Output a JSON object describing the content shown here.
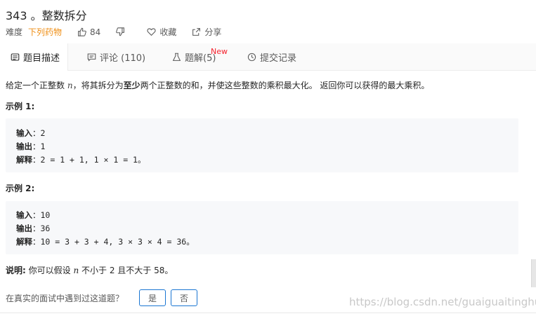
{
  "problem": {
    "title": "343 。整数拆分",
    "difficulty_label": "难度",
    "difficulty_value": "下列药物",
    "likes": "84",
    "favorite_label": "收藏",
    "share_label": "分享"
  },
  "tabs": [
    {
      "label": "题目描述"
    },
    {
      "label": "评论 (110)"
    },
    {
      "label": "题解(5)",
      "badge": "New"
    },
    {
      "label": "提交记录"
    }
  ],
  "description": {
    "part1": "给定一个正整数 ",
    "var": "n",
    "part2": "，将其拆分为",
    "bold": "至少",
    "part3": "两个正整数的和，并使这些整数的乘积最大化。 返回你可以获得的最大乘积。"
  },
  "examples": [
    {
      "title": "示例 1:",
      "input_label": "输入",
      "input": "：2",
      "output_label": "输出",
      "output": "：1",
      "explain_label": "解释",
      "explain": "：2 = 1 + 1, 1 × 1 = 1。"
    },
    {
      "title": "示例 2:",
      "input_label": "输入",
      "input": "：10",
      "output_label": "输出",
      "output": "：36",
      "explain_label": "解释",
      "explain": "：10 = 3 + 3 + 4, 3 × 3 × 4 = 36。"
    }
  ],
  "note": {
    "label": "说明:",
    "part1": " 你可以假设 ",
    "var": "n",
    "part2": " 不小于 2 且不大于 58。"
  },
  "interview": {
    "question": "在真实的面试中遇到过这道题？",
    "yes": "是",
    "no": "否"
  },
  "watermark": "https://blog.csdn.net/guaiguaitinghua",
  "colors": {
    "difficulty": "#ef8e14",
    "badge": "#f5222d",
    "button_border": "#1a76d2"
  }
}
